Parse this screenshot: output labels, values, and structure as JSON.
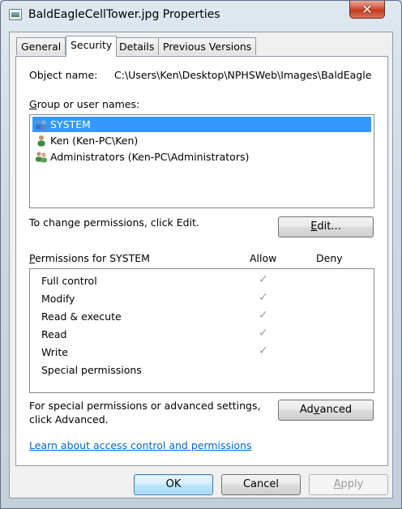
{
  "window": {
    "title": "BaldEagleCellTower.jpg Properties",
    "close_glyph": "✕"
  },
  "tabs": [
    {
      "label": "General",
      "active": false
    },
    {
      "label": "Security",
      "active": true
    },
    {
      "label": "Details",
      "active": false
    },
    {
      "label": "Previous Versions",
      "active": false
    }
  ],
  "security": {
    "object_name_label": "Object name:",
    "object_name_value": "C:\\Users\\Ken\\Desktop\\NPHSWeb\\Images\\BaldEagle",
    "group_label_accel": "G",
    "group_label_rest": "roup or user names:",
    "users": [
      {
        "name": "SYSTEM",
        "icon": "users-group-icon",
        "selected": true
      },
      {
        "name": "Ken (Ken-PC\\Ken)",
        "icon": "user-icon",
        "selected": false
      },
      {
        "name": "Administrators (Ken-PC\\Administrators)",
        "icon": "users-group-icon",
        "selected": false
      }
    ],
    "change_text": "To change permissions, click Edit.",
    "edit_accel": "E",
    "edit_rest": "dit...",
    "permissions_label_accel": "P",
    "permissions_label_rest": "ermissions for SYSTEM",
    "allow_header": "Allow",
    "deny_header": "Deny",
    "permissions": [
      {
        "name": "Full control",
        "allow": true,
        "deny": false
      },
      {
        "name": "Modify",
        "allow": true,
        "deny": false
      },
      {
        "name": "Read & execute",
        "allow": true,
        "deny": false
      },
      {
        "name": "Read",
        "allow": true,
        "deny": false
      },
      {
        "name": "Write",
        "allow": true,
        "deny": false
      },
      {
        "name": "Special permissions",
        "allow": false,
        "deny": false
      }
    ],
    "check_glyph": "✓",
    "advanced_text_line1": "For special permissions or advanced settings,",
    "advanced_text_line2": "click Advanced.",
    "advanced_pre": "Ad",
    "advanced_accel": "v",
    "advanced_post": "anced",
    "help_link": "Learn about access control and permissions"
  },
  "footer": {
    "ok": "OK",
    "cancel": "Cancel",
    "apply_accel": "A",
    "apply_rest": "pply"
  },
  "colors": {
    "selection": "#3399ff",
    "link": "#0066cc",
    "close": "#c0391e"
  }
}
